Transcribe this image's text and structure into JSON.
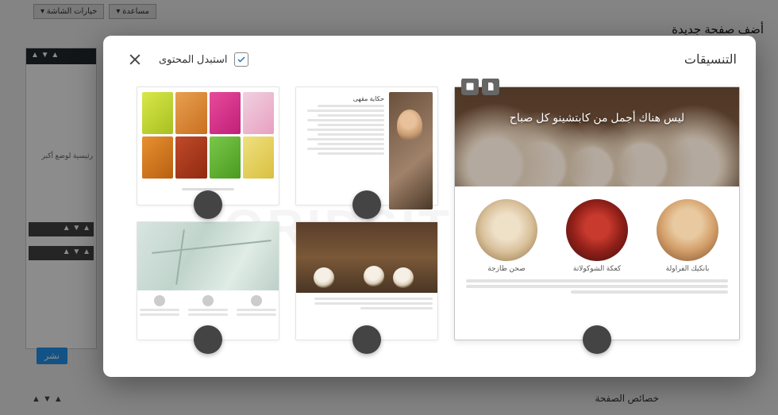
{
  "background": {
    "page_title": "أضف صفحة جديدة",
    "screen_options": "خيارات الشاشة ▾",
    "help": "مساعدة ▾",
    "sidebar_note": "رئيسية لوضع أكبر",
    "publish": "نشر",
    "page_attrs": "خصائص الصفحة"
  },
  "modal": {
    "title": "التنسيقات",
    "replace_content_label": "استبدل المحتوى"
  },
  "templates": {
    "big": {
      "hero_text": "ليس هناك أجمل من كابتشينو كل صباح",
      "desserts": [
        {
          "label": "بانكيك الفراولة"
        },
        {
          "label": "كعكة الشوكولاتة"
        },
        {
          "label": "صحن طازجة"
        }
      ]
    },
    "about_title": "حكاية مقهى"
  },
  "watermark": "ORIDSITE.COM"
}
